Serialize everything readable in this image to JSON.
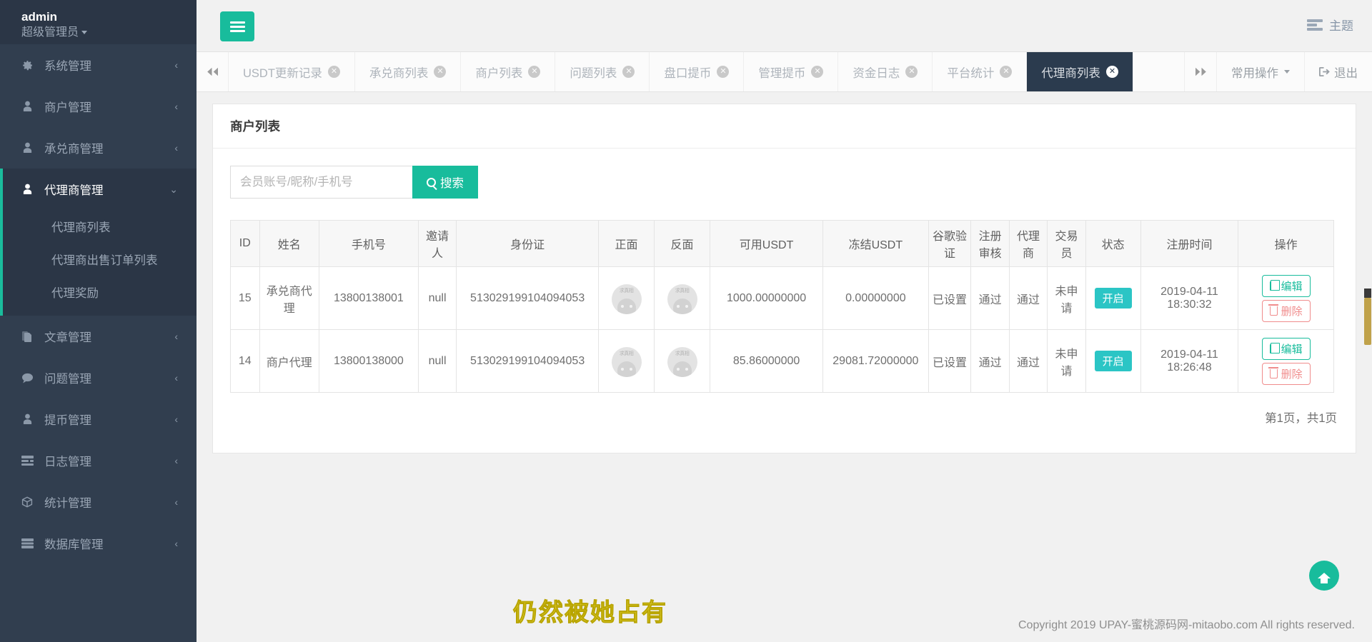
{
  "sidebar": {
    "user": {
      "name": "admin",
      "role": "超级管理员"
    },
    "items": [
      {
        "label": "系统管理",
        "icon": "gear-icon",
        "arrow": "‹"
      },
      {
        "label": "商户管理",
        "icon": "user-icon",
        "arrow": "‹"
      },
      {
        "label": "承兑商管理",
        "icon": "user-icon",
        "arrow": "‹"
      },
      {
        "label": "代理商管理",
        "icon": "user-icon",
        "arrow": "⌄",
        "active": true,
        "children": [
          "代理商列表",
          "代理商出售订单列表",
          "代理奖励"
        ]
      },
      {
        "label": "文章管理",
        "icon": "file-icon",
        "arrow": "‹"
      },
      {
        "label": "问题管理",
        "icon": "comment-icon",
        "arrow": "‹"
      },
      {
        "label": "提币管理",
        "icon": "user-icon",
        "arrow": "‹"
      },
      {
        "label": "日志管理",
        "icon": "list-icon",
        "arrow": "‹"
      },
      {
        "label": "统计管理",
        "icon": "cube-icon",
        "arrow": "‹"
      },
      {
        "label": "数据库管理",
        "icon": "database-icon",
        "arrow": "‹"
      }
    ]
  },
  "topbar": {
    "menu_toggle_icon": "hamburger-icon",
    "theme_label": "主题",
    "theme_icon": "theme-icon"
  },
  "tabbar": {
    "scroll_left_icon": "chevron-double-left-icon",
    "scroll_right_icon": "chevron-double-right-icon",
    "tabs": [
      {
        "label": "USDT更新记录",
        "active": false
      },
      {
        "label": "承兑商列表",
        "active": false
      },
      {
        "label": "商户列表",
        "active": false
      },
      {
        "label": "问题列表",
        "active": false
      },
      {
        "label": "盘口提币",
        "active": false
      },
      {
        "label": "管理提币",
        "active": false
      },
      {
        "label": "资金日志",
        "active": false
      },
      {
        "label": "平台统计",
        "active": false
      },
      {
        "label": "代理商列表",
        "active": true
      }
    ],
    "close_glyph": "✕",
    "common_ops_label": "常用操作",
    "logout_label": "退出",
    "logout_icon": "logout-icon"
  },
  "panel": {
    "title": "商户列表",
    "search": {
      "placeholder": "会员账号/昵称/手机号",
      "value": "",
      "button_label": "搜索",
      "button_icon": "search-icon"
    },
    "columns": [
      "ID",
      "姓名",
      "手机号",
      "邀请人",
      "身份证",
      "正面",
      "反面",
      "可用USDT",
      "冻结USDT",
      "谷歌验证",
      "注册审核",
      "代理商",
      "交易员",
      "状态",
      "注册时间",
      "操作"
    ],
    "rows": [
      {
        "id": "15",
        "name": "承兑商代理",
        "phone": "13800138001",
        "inviter": "null",
        "idcard": "513029199104094053",
        "front": "avatar-image",
        "back": "avatar-image",
        "available_usdt": "1000.00000000",
        "frozen_usdt": "0.00000000",
        "google_auth": "已设置",
        "register_review": "通过",
        "agent": "通过",
        "trader": "未申请",
        "status": "开启",
        "register_time": "2019-04-11 18:30:32",
        "actions": {
          "edit": "编辑",
          "delete": "删除"
        }
      },
      {
        "id": "14",
        "name": "商户代理",
        "phone": "13800138000",
        "inviter": "null",
        "idcard": "513029199104094053",
        "front": "avatar-image",
        "back": "avatar-image",
        "available_usdt": "85.86000000",
        "frozen_usdt": "29081.72000000",
        "google_auth": "已设置",
        "register_review": "通过",
        "agent": "通过",
        "trader": "未申请",
        "status": "开启",
        "register_time": "2019-04-11 18:26:48",
        "actions": {
          "edit": "编辑",
          "delete": "删除"
        }
      }
    ],
    "pager": "第1页，共1页",
    "avatar_watermark": "求真相"
  },
  "footer": {
    "watermark": "仍然被她占有",
    "copyright": "Copyright 2019 UPAY-蜜桃源码网-mitaobo.com All rights reserved.",
    "home_icon": "home-icon"
  },
  "colors": {
    "accent": "#18bc9c",
    "sidebar_bg": "#313e4f",
    "sidebar_active_bg": "#2b3646",
    "tab_active_bg": "#2b3b4e",
    "status_badge": "#2bc5c5",
    "delete": "#f08c8c",
    "watermark": "#f0e24a"
  }
}
